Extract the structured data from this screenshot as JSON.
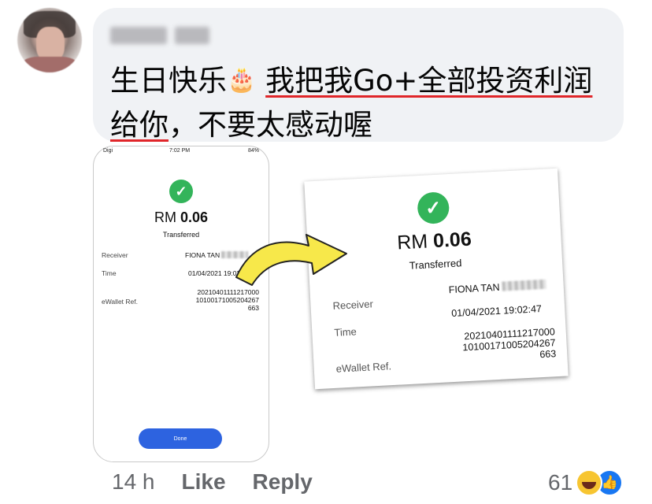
{
  "comment": {
    "text_part1": "生日快乐",
    "text_underlined": "我把我Go+全部投资利润给你",
    "text_part2": "，不要太感动喔",
    "cake_icon": "birthday-cake-icon"
  },
  "phone_screenshot": {
    "status_left": "Digi",
    "status_time": "7:02 PM",
    "status_right": "84%",
    "amount_prefix": "RM",
    "amount_value": "0.06",
    "status_text": "Transferred",
    "receiver_label": "Receiver",
    "receiver_value": "FIONA TAN",
    "time_label": "Time",
    "time_value": "01/04/2021 19:02:47",
    "ref_label": "eWallet Ref.",
    "ref_line1": "20210401111217000",
    "ref_line2": "10100171005204267",
    "ref_line3": "663",
    "done_label": "Done"
  },
  "zoomed_receipt": {
    "amount_prefix": "RM",
    "amount_value": "0.06",
    "status_text": "Transferred",
    "receiver_label": "Receiver",
    "receiver_value": "FIONA TAN",
    "time_label": "Time",
    "time_value": "01/04/2021 19:02:47",
    "ref_label": "eWallet Ref.",
    "ref_line1": "20210401111217000",
    "ref_line2": "10100171005204267",
    "ref_line3": "663"
  },
  "actions": {
    "timestamp": "14 h",
    "like_label": "Like",
    "reply_label": "Reply",
    "reaction_count": "61"
  },
  "colors": {
    "bubble": "#f0f2f5",
    "underline": "#e0262a",
    "success": "#33b45a",
    "done_button": "#2d63e0",
    "arrow": "#f7e84a"
  }
}
